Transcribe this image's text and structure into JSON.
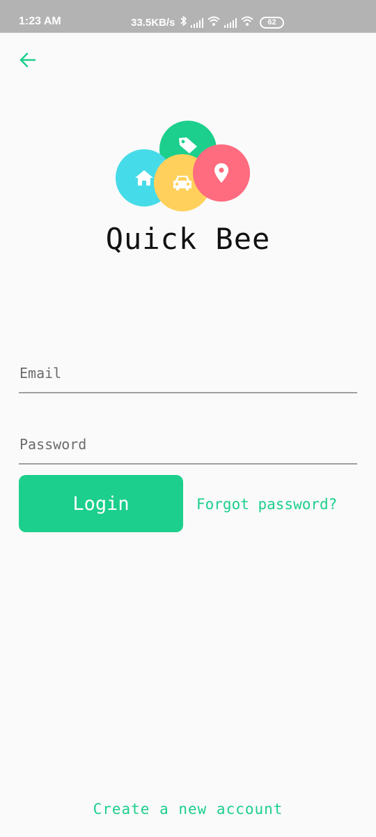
{
  "status_bar": {
    "time": "1:23 AM",
    "speed": "33.5KB/s",
    "battery": "62",
    "icons": [
      "bluetooth-icon",
      "signal-icon",
      "wifi-icon",
      "signal-icon",
      "wifi-icon",
      "battery-icon"
    ]
  },
  "nav": {
    "back_icon": "arrow-left-icon"
  },
  "logo": {
    "icons": [
      "home-icon",
      "tag-icon",
      "car-icon",
      "location-pin-icon"
    ],
    "colors": {
      "cyan": "#46dbe8",
      "green": "#1ccf8c",
      "yellow": "#ffd15c",
      "pink": "#ff6b7f"
    }
  },
  "app": {
    "title": "Quick Bee"
  },
  "form": {
    "email_placeholder": "Email",
    "password_placeholder": "Password",
    "login_label": "Login",
    "forgot_label": "Forgot password?"
  },
  "footer": {
    "create_account_label": "Create a new account"
  },
  "theme": {
    "accent": "#1ccf8c",
    "background": "#fafafa",
    "statusbar": "#b3b3b3"
  }
}
